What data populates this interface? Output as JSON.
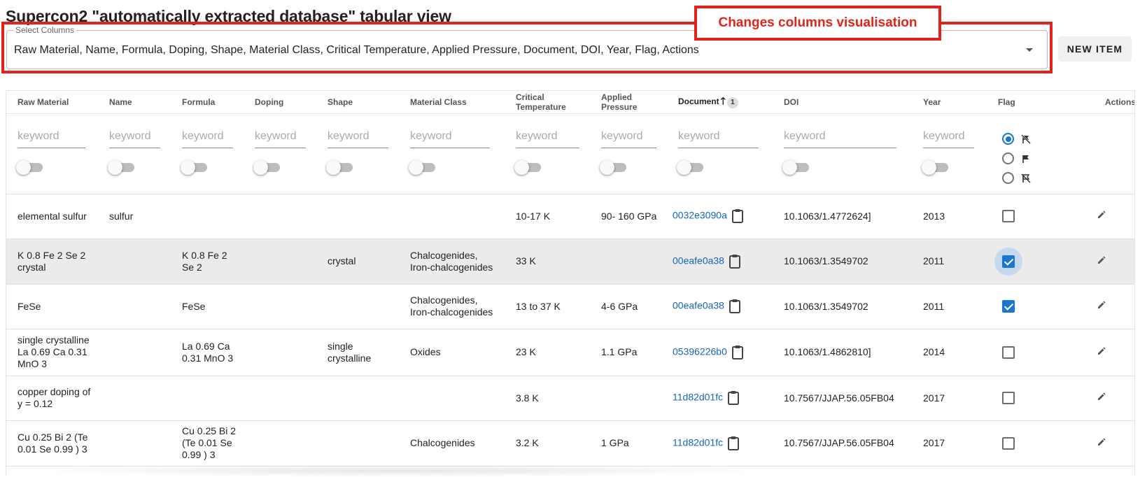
{
  "page": {
    "title": "Supercon2 \"automatically extracted database\" tabular view",
    "annotation": "Changes columns visualisation"
  },
  "select": {
    "label": "Select Columns",
    "value": "Raw Material, Name, Formula, Doping, Shape, Material Class, Critical Temperature, Applied Pressure, Document, DOI, Year, Flag, Actions"
  },
  "toolbar": {
    "new_item_label": "NEW ITEM"
  },
  "table": {
    "headers": {
      "raw_material": "Raw Material",
      "name": "Name",
      "formula": "Formula",
      "doping": "Doping",
      "shape": "Shape",
      "material_class": "Material Class",
      "critical_temperature": "Critical Temperature",
      "applied_pressure": "Applied Pressure",
      "document": "Document",
      "doi": "DOI",
      "year": "Year",
      "flag": "Flag",
      "actions": "Actions"
    },
    "sort": {
      "direction": "ascending",
      "badge": "1"
    },
    "filter_placeholder": "keyword",
    "flag_filter_selected": "all",
    "rows": [
      {
        "raw_material": "elemental sulfur",
        "name": "sulfur",
        "formula": "",
        "doping": "",
        "shape": "",
        "material_class": "",
        "critical_temperature": "10-17 K",
        "applied_pressure": "90- 160 GPa",
        "document": "0032e3090a",
        "doi": "10.1063/1.4772624]",
        "year": "2013",
        "flag": false
      },
      {
        "raw_material": "K 0.8 Fe 2 Se 2 crystal",
        "name": "",
        "formula": "K 0.8 Fe 2 Se 2",
        "doping": "",
        "shape": "crystal",
        "material_class": "Chalcogenides, Iron-chalcogenides",
        "critical_temperature": "33 K",
        "applied_pressure": "",
        "document": "00eafe0a38",
        "doi": "10.1063/1.3549702",
        "year": "2011",
        "flag": true
      },
      {
        "raw_material": "FeSe",
        "name": "",
        "formula": "FeSe",
        "doping": "",
        "shape": "",
        "material_class": "Chalcogenides, Iron-chalcogenides",
        "critical_temperature": "13 to 37 K",
        "applied_pressure": "4-6 GPa",
        "document": "00eafe0a38",
        "doi": "10.1063/1.3549702",
        "year": "2011",
        "flag": true
      },
      {
        "raw_material": "single crystalline La 0.69 Ca 0.31 MnO 3",
        "name": "",
        "formula": "La 0.69 Ca 0.31 MnO 3",
        "doping": "",
        "shape": "single crystalline",
        "material_class": "Oxides",
        "critical_temperature": "23 K",
        "applied_pressure": "1.1 GPa",
        "document": "05396226b0",
        "doi": "10.1063/1.4862810]",
        "year": "2014",
        "flag": false
      },
      {
        "raw_material": "copper doping of y = 0.12",
        "name": "",
        "formula": "",
        "doping": "",
        "shape": "",
        "material_class": "",
        "critical_temperature": "3.8 K",
        "applied_pressure": "",
        "document": "11d82d01fc",
        "doi": "10.7567/JJAP.56.05FB04",
        "year": "2017",
        "flag": false
      },
      {
        "raw_material": "Cu 0.25 Bi 2 (Te 0.01 Se 0.99 ) 3",
        "name": "",
        "formula": "Cu 0.25 Bi 2 (Te 0.01 Se 0.99 ) 3",
        "doping": "",
        "shape": "",
        "material_class": "Chalcogenides",
        "critical_temperature": "3.2 K",
        "applied_pressure": "1 GPa",
        "document": "11d82d01fc",
        "doi": "10.7567/JJAP.56.05FB04",
        "year": "2017",
        "flag": false
      }
    ]
  },
  "colors": {
    "accent": "#1976d2",
    "annotation": "#e0241b",
    "link": "#1565c0"
  }
}
